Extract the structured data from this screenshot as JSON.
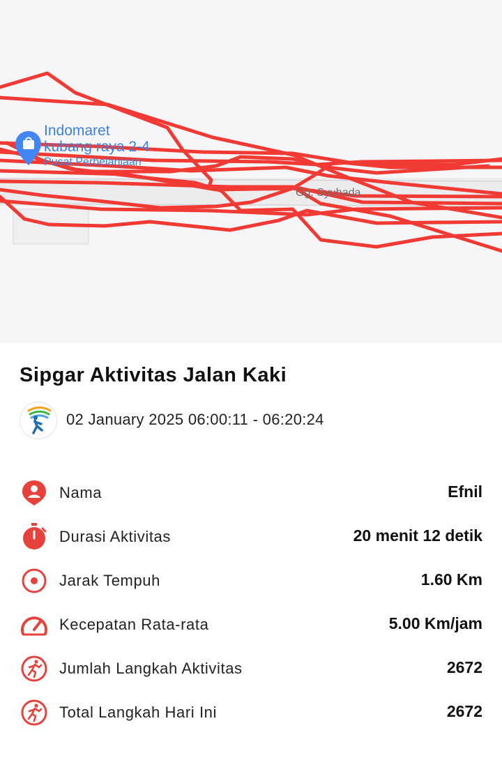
{
  "map": {
    "poi": {
      "name_line1": "Indomaret",
      "name_line2": "kubang raya 2-4",
      "category": "Pusat Perbelanjaan",
      "icon": "shopping-bag-pin-icon"
    },
    "street": "Gg. Syuhada",
    "route_color": "#f03a33"
  },
  "activity": {
    "title": "Sipgar Aktivitas Jalan Kaki",
    "datetime": "02 January 2025 06:00:11 - 06:20:24",
    "logo_icon": "sipgar-walker-logo"
  },
  "stats": [
    {
      "icon": "user-pin-icon",
      "label": "Nama",
      "value": "Efnil"
    },
    {
      "icon": "stopwatch-icon",
      "label": "Durasi Aktivitas",
      "value": "20 menit 12 detik"
    },
    {
      "icon": "target-icon",
      "label": "Jarak Tempuh",
      "value": "1.60 Km"
    },
    {
      "icon": "speedometer-icon",
      "label": "Kecepatan Rata-rata",
      "value": "5.00 Km/jam"
    },
    {
      "icon": "runner-icon",
      "label": "Jumlah Langkah Aktivitas",
      "value": "2672"
    },
    {
      "icon": "runner-icon",
      "label": "Total Langkah Hari Ini",
      "value": "2672"
    }
  ],
  "colors": {
    "accent_red": "#e8403a",
    "poi_blue": "#3b7fe0"
  }
}
